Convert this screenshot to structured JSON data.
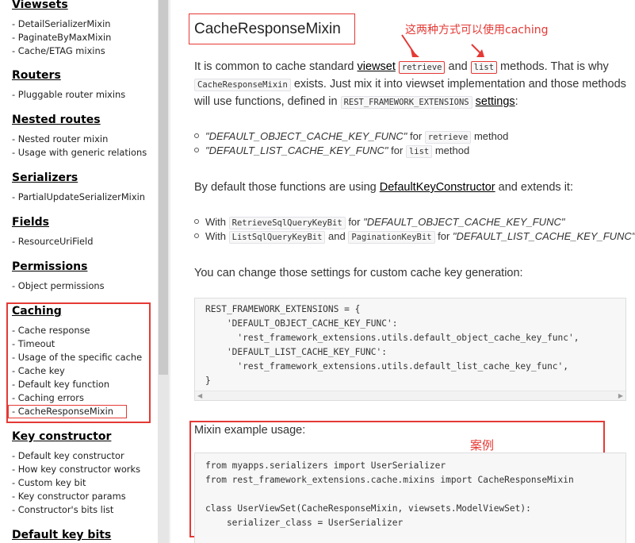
{
  "sidebar": {
    "sections": [
      {
        "title": "Viewsets",
        "items": [
          "DetailSerializerMixin",
          "PaginateByMaxMixin",
          "Cache/ETAG mixins"
        ]
      },
      {
        "title": "Routers",
        "items": [
          "Pluggable router mixins"
        ]
      },
      {
        "title": "Nested routes",
        "items": [
          "Nested router mixin",
          "Usage with generic relations"
        ]
      },
      {
        "title": "Serializers",
        "items": [
          "PartialUpdateSerializerMixin"
        ]
      },
      {
        "title": "Fields",
        "items": [
          "ResourceUriField"
        ]
      },
      {
        "title": "Permissions",
        "items": [
          "Object permissions"
        ]
      },
      {
        "title": "Caching",
        "items": [
          "Cache response",
          "Timeout",
          "Usage of the specific cache",
          "Cache key",
          "Default key function",
          "Caching errors",
          "CacheResponseMixin"
        ]
      },
      {
        "title": "Key constructor",
        "items": [
          "Default key constructor",
          "How key constructor works",
          "Custom key bit",
          "Key constructor params",
          "Constructor's bits list"
        ]
      },
      {
        "title": "Default key bits",
        "items": []
      }
    ],
    "item_prefix": "- "
  },
  "main": {
    "heading": "CacheResponseMixin",
    "annotation_top": "这两种方式可以使用caching",
    "annotation_example": "案例",
    "para1": {
      "t1": "It is common to cache standard ",
      "viewset": "viewset",
      "code_retrieve": "retrieve",
      "and": " and ",
      "code_list": "list",
      "t2": " methods. That is why",
      "code_mixin": "CacheResponseMixin",
      "t3": " exists. Just mix it into viewset implementation and those methods",
      "t4": "will use functions, defined in ",
      "code_ext": "REST_FRAMEWORK_EXTENSIONS",
      "settings": "settings",
      "colon": ":"
    },
    "bullets1": [
      {
        "em": "\"DEFAULT_OBJECT_CACHE_KEY_FUNC\"",
        "for": " for ",
        "code": "retrieve",
        "tail": " method"
      },
      {
        "em": "\"DEFAULT_LIST_CACHE_KEY_FUNC\"",
        "for": " for ",
        "code": "list",
        "tail": " method"
      }
    ],
    "para2": {
      "t1": "By default those functions are using ",
      "link": "DefaultKeyConstructor",
      "t2": " and extends it:"
    },
    "bullets2": [
      {
        "with": "With ",
        "code1": "RetrieveSqlQueryKeyBit",
        "for": " for ",
        "em": "\"DEFAULT_OBJECT_CACHE_KEY_FUNC\""
      },
      {
        "with": "With ",
        "code1": "ListSqlQueryKeyBit",
        "and": " and ",
        "code2": "PaginationKeyBit",
        "for": " for ",
        "em": "\"DEFAULT_LIST_CACHE_KEY_FUNC\""
      }
    ],
    "para3": "You can change those settings for custom cache key generation:",
    "code1": [
      "REST_FRAMEWORK_EXTENSIONS = {",
      "    'DEFAULT_OBJECT_CACHE_KEY_FUNC':",
      "      'rest_framework_extensions.utils.default_object_cache_key_func',",
      "    'DEFAULT_LIST_CACHE_KEY_FUNC':",
      "      'rest_framework_extensions.utils.default_list_cache_key_func',",
      "}"
    ],
    "para4": "Mixin example usage:",
    "code2": [
      "from myapps.serializers import UserSerializer",
      "from rest_framework_extensions.cache.mixins import CacheResponseMixin",
      "",
      "class UserViewSet(CacheResponseMixin, viewsets.ModelViewSet):",
      "    serializer_class = UserSerializer"
    ],
    "scroll_left": "◀",
    "scroll_right": "▶"
  },
  "colors": {
    "annotation_red": "#e53935",
    "code_bg": "#f7f7f7"
  }
}
